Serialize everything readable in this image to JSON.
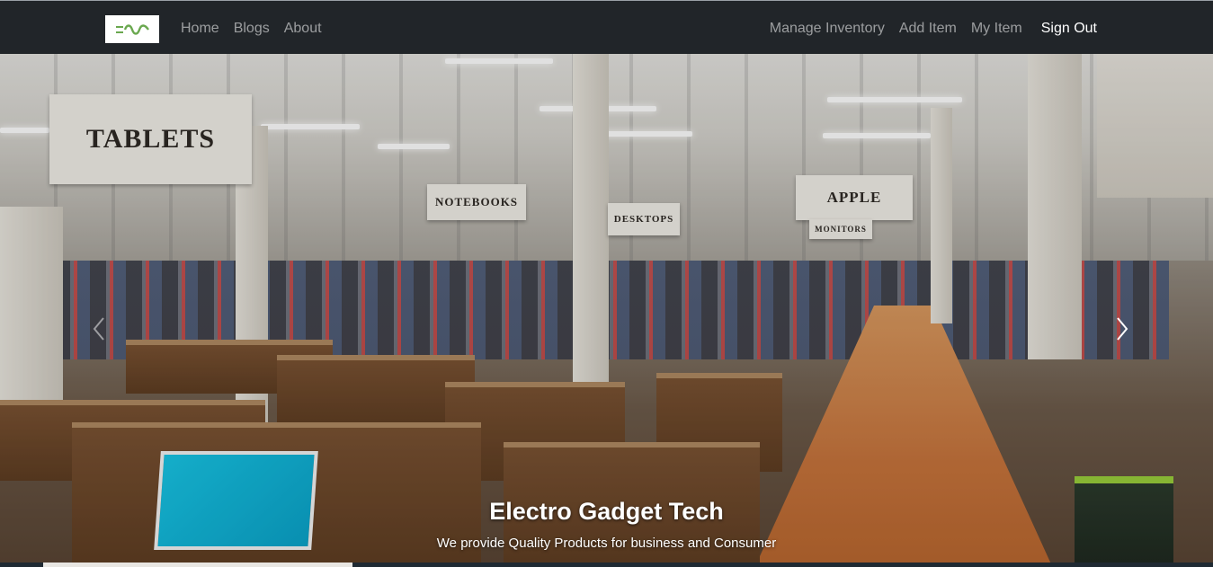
{
  "navbar": {
    "logo": "logo-icon",
    "left_links": [
      {
        "label": "Home"
      },
      {
        "label": "Blogs"
      },
      {
        "label": "About"
      }
    ],
    "right_links": [
      {
        "label": "Manage Inventory"
      },
      {
        "label": "Add Item"
      },
      {
        "label": "My Item"
      },
      {
        "label": "Sign Out"
      }
    ]
  },
  "hero": {
    "signs": {
      "tablets": "TABLETS",
      "notebooks": "NOTEBOOKS",
      "desktops": "DESKTOPS",
      "apple": "APPLE",
      "monitors": "MONITORS"
    },
    "caption_title": "Electro Gadget Tech",
    "caption_subtitle": "We provide Quality Products for business and Consumer",
    "next_icon": "chevron-right-icon",
    "prev_icon": "chevron-left-icon"
  },
  "colors": {
    "navbar_bg": "#212529",
    "nav_link": "rgba(255,255,255,0.55)",
    "nav_link_active": "#ffffff",
    "logo_green": "#6aa84f"
  }
}
